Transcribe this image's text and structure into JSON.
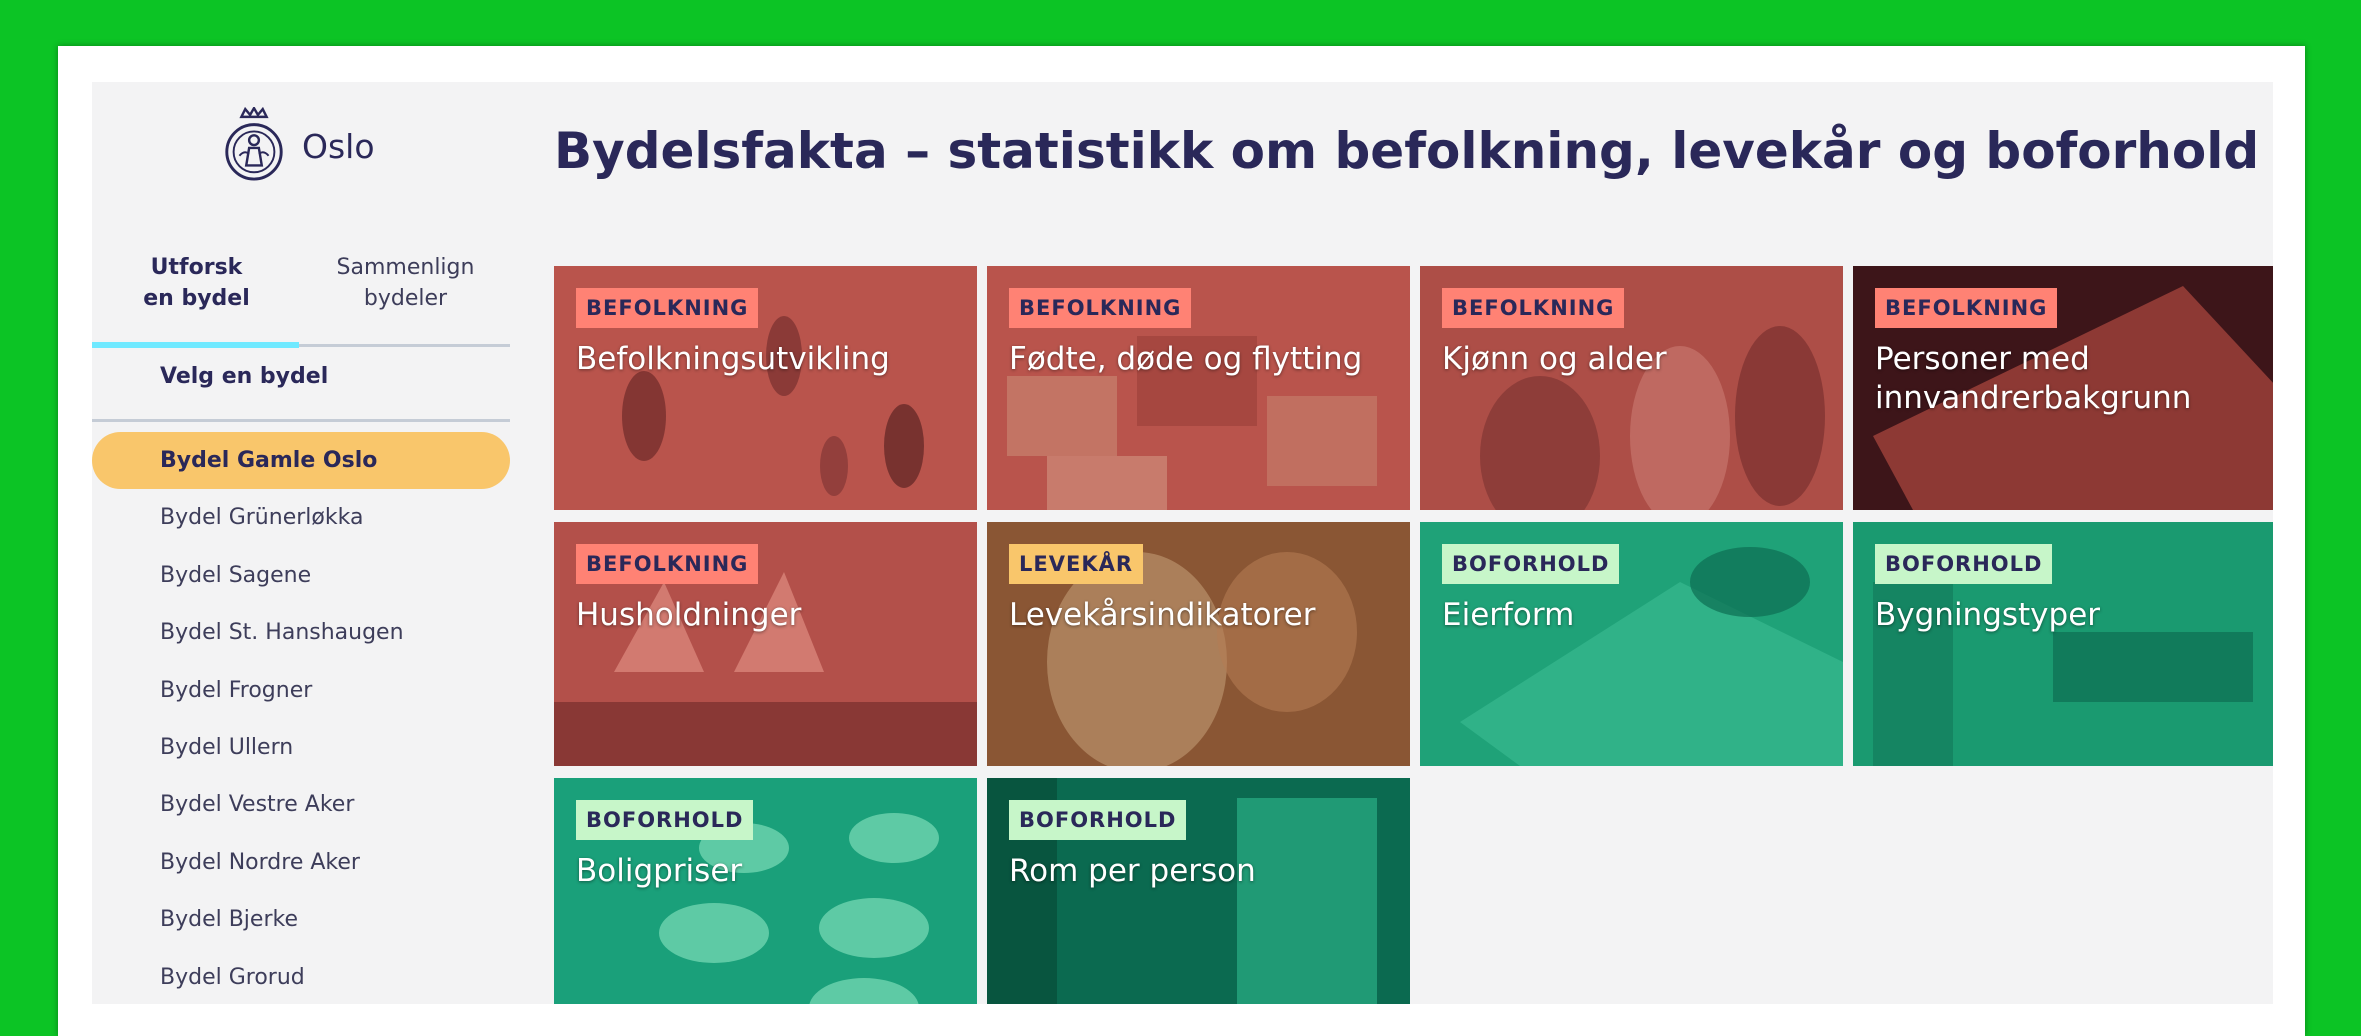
{
  "header": {
    "logo_text": "Oslo",
    "title": "Bydelsfakta – statistikk om befolkning, levekår og boforhold"
  },
  "sidebar": {
    "tabs": [
      {
        "line1": "Utforsk",
        "line2": "en bydel"
      },
      {
        "line1": "Sammenlign",
        "line2": "bydeler"
      }
    ],
    "select_label": "Velg en bydel",
    "items": [
      "Bydel Gamle Oslo",
      "Bydel Grünerløkka",
      "Bydel Sagene",
      "Bydel St. Hanshaugen",
      "Bydel Frogner",
      "Bydel Ullern",
      "Bydel Vestre Aker",
      "Bydel Nordre Aker",
      "Bydel Bjerke",
      "Bydel Grorud"
    ],
    "selected_index": 0
  },
  "cards": [
    {
      "tag": "BEFOLKNING",
      "name": "Befolkningsutvikling"
    },
    {
      "tag": "BEFOLKNING",
      "name": "Fødte, døde og flytting"
    },
    {
      "tag": "BEFOLKNING",
      "name": "Kjønn og alder"
    },
    {
      "tag": "BEFOLKNING",
      "name": "Personer med innvandrerbakgrunn"
    },
    {
      "tag": "BEFOLKNING",
      "name": "Husholdninger"
    },
    {
      "tag": "LEVEKÅR",
      "name": "Levekårsindikatorer"
    },
    {
      "tag": "BOFORHOLD",
      "name": "Eierform"
    },
    {
      "tag": "BOFORHOLD",
      "name": "Bygningstyper"
    },
    {
      "tag": "BOFORHOLD",
      "name": "Boligpriser"
    },
    {
      "tag": "BOFORHOLD",
      "name": "Rom per person"
    }
  ],
  "colors": {
    "page_background": "#0cc425",
    "navy": "#2a2859",
    "selected_item": "#f9c66b",
    "tab_indicator": "#6fe9ff",
    "tag_befolkning": "#ff8274",
    "tag_levekar": "#f9c66b",
    "tag_boforhold": "#c7f6c9"
  }
}
